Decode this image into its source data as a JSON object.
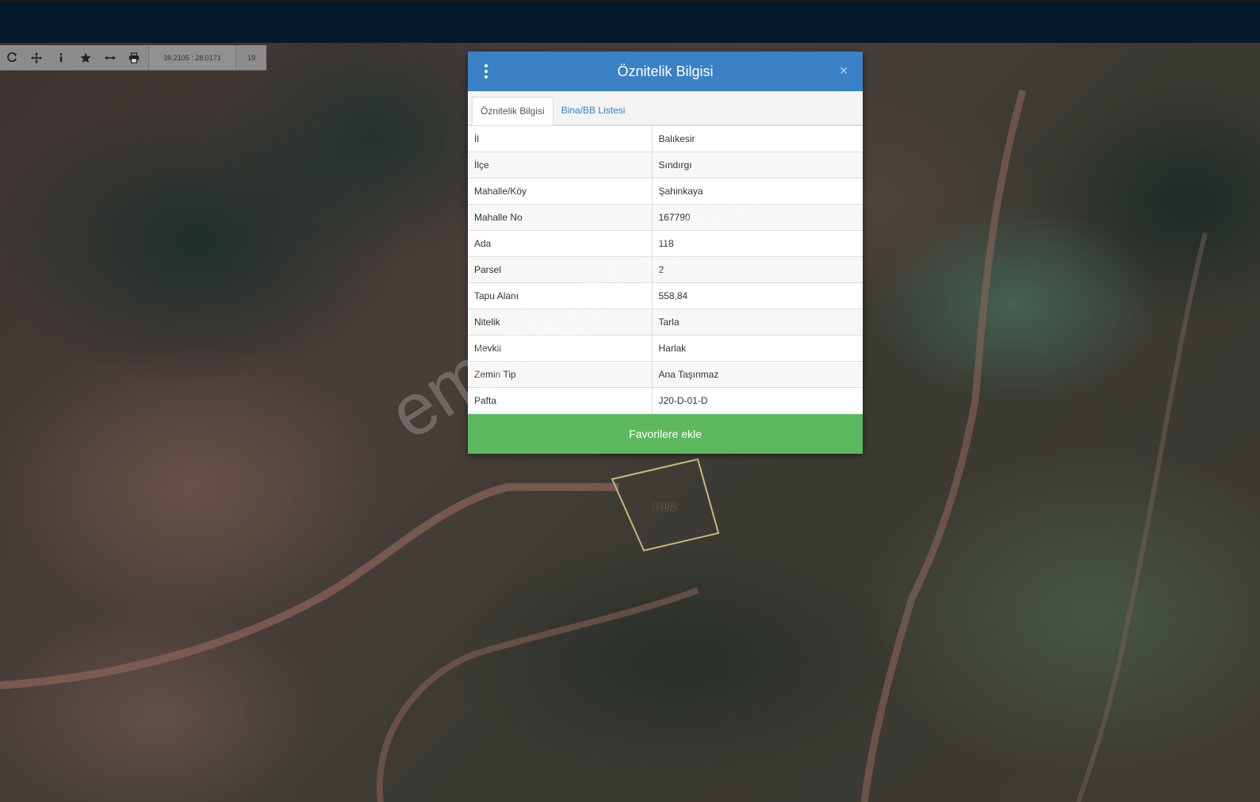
{
  "toolbar": {
    "buttons": [
      {
        "name": "refresh-button",
        "icon": "refresh-icon"
      },
      {
        "name": "pan-button",
        "icon": "move-icon"
      },
      {
        "name": "info-button",
        "icon": "info-icon"
      },
      {
        "name": "favorite-button",
        "icon": "star-icon"
      },
      {
        "name": "measure-button",
        "icon": "arrows-horizontal-icon"
      },
      {
        "name": "print-button",
        "icon": "print-icon"
      }
    ],
    "coordinates": "39.2105 : 28.0171",
    "zoom_level": "19"
  },
  "panel": {
    "title": "Öznitelik Bilgisi",
    "close_label": "×",
    "tabs": [
      {
        "label": "Öznitelik Bilgisi",
        "active": true
      },
      {
        "label": "Bina/BB Listesi",
        "active": false
      }
    ],
    "rows": [
      {
        "key": "İl",
        "value": "Balıkesir"
      },
      {
        "key": "İlçe",
        "value": "Sındırgı"
      },
      {
        "key": "Mahalle/Köy",
        "value": "Şahinkaya"
      },
      {
        "key": "Mahalle No",
        "value": "167790"
      },
      {
        "key": "Ada",
        "value": "118"
      },
      {
        "key": "Parsel",
        "value": "2"
      },
      {
        "key": "Tapu Alanı",
        "value": "558,84"
      },
      {
        "key": "Nitelik",
        "value": "Tarla"
      },
      {
        "key": "Mevkii",
        "value": "Harlak"
      },
      {
        "key": "Zemin Tip",
        "value": "Ana Taşınmaz"
      },
      {
        "key": "Pafta",
        "value": "J20-D-01-D"
      }
    ],
    "favorite_button_label": "Favorilere ekle"
  },
  "map": {
    "parcel_label": "118/2",
    "parcel_outline_color": "#c9b77a"
  },
  "watermark": "emlakjet.com",
  "colors": {
    "header_blue": "#3a81c5",
    "button_green": "#5cb85c",
    "topbar": "#04192a"
  }
}
